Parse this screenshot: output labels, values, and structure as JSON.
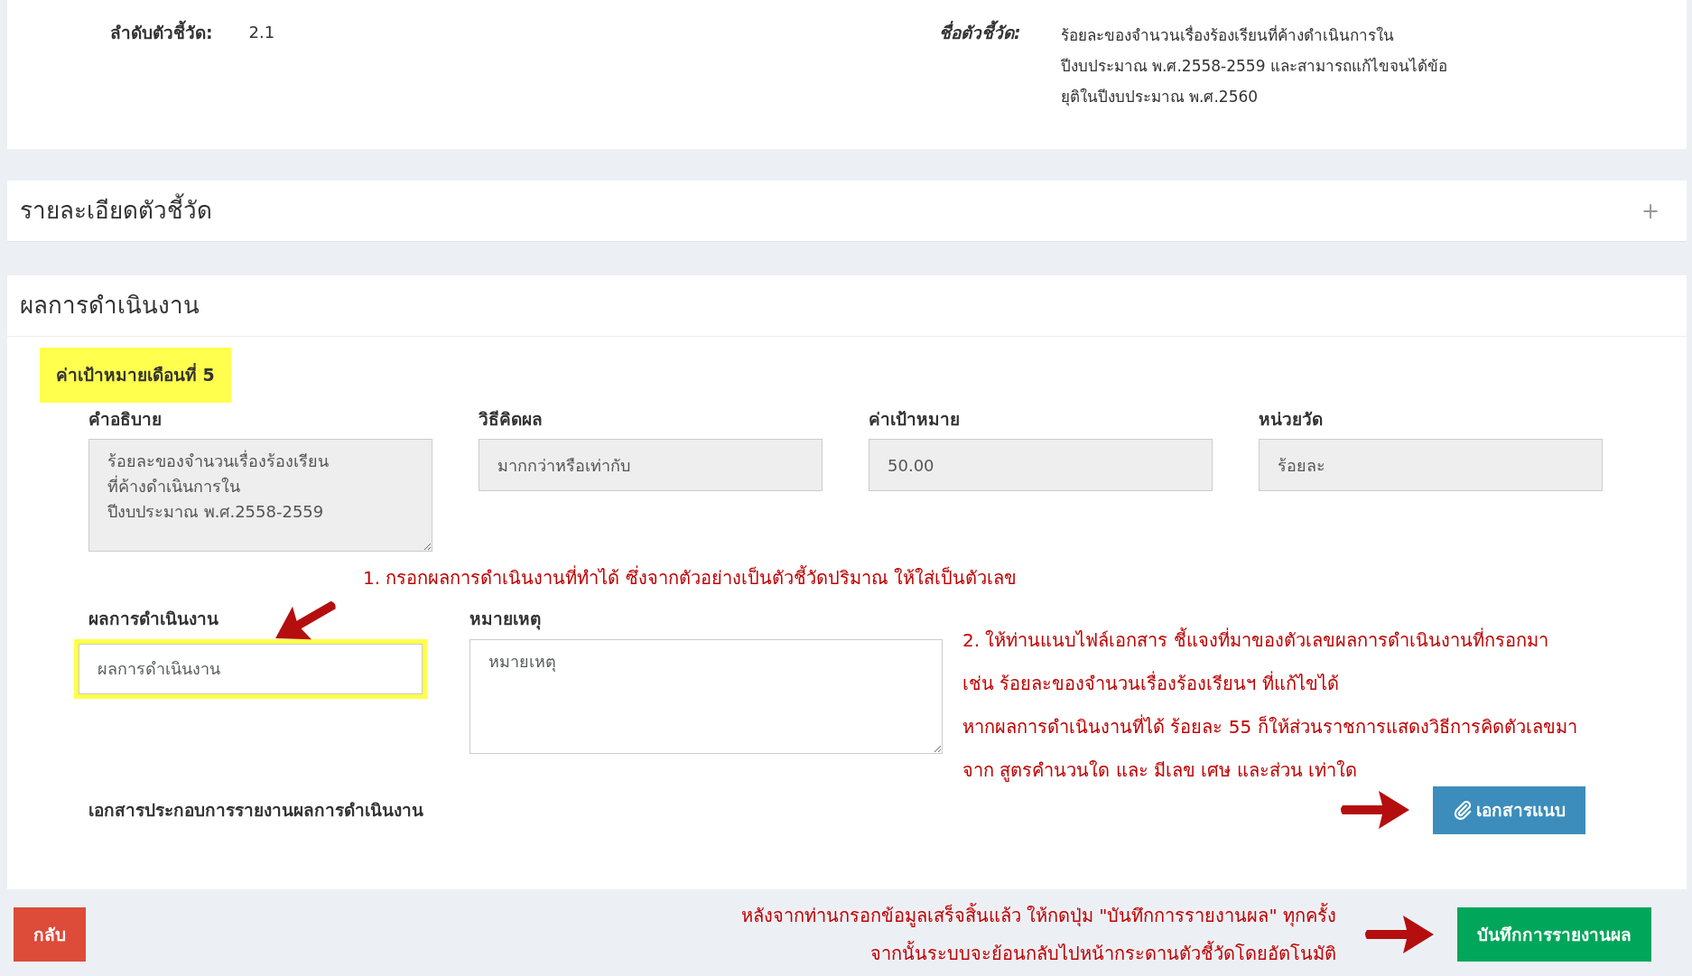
{
  "indicator": {
    "order_label": "ลำดับตัวชี้วัด:",
    "order": "2.1",
    "name_label": "ชื่อตัวชี้วัด:",
    "name_lines": [
      "ร้อยละของจำนวนเรื่องร้องเรียนที่ค้างดำเนินการใน",
      "ปีงบประมาณ พ.ศ.2558-2559 และสามารถแก้ไขจนได้ข้อ",
      "ยุติในปีงบประมาณ พ.ศ.2560"
    ]
  },
  "details_panel": {
    "title": "รายละเอียดตัวชี้วัด",
    "toggle": "+"
  },
  "results_panel": {
    "title": "ผลการดำเนินงาน",
    "target_tag": "ค่าเป้าหมายเดือนที่ 5",
    "target_fields": [
      {
        "kind": "textarea",
        "label": "คำอธิบาย",
        "value": "ร้อยละของจำนวนเรื่องร้องเรียน\nที่ค้างดำเนินการใน\nปีงบประมาณ พ.ศ.2558-2559",
        "disabled": true
      },
      {
        "kind": "select",
        "label": "วิธีคิดผล",
        "value": "มากกว่าหรือเท่ากับ",
        "disabled": true
      },
      {
        "kind": "input",
        "label": "ค่าเป้าหมาย",
        "value": "50.00",
        "disabled": true
      },
      {
        "kind": "input",
        "label": "หน่วยวัด",
        "value": "ร้อยละ",
        "disabled": true
      }
    ],
    "note_1": "1. กรอกผลการดำเนินงานที่ทำได้ ซึ่งจากตัวอย่างเป็นตัวชี้วัดปริมาณ ให้ใส่เป็นตัวเลข",
    "entry_fields": [
      {
        "kind": "input",
        "label": "ผลการดำเนินงาน",
        "placeholder": "ผลการดำเนินงาน",
        "disabled": false,
        "highlighted": true
      },
      {
        "kind": "textarea",
        "label": "หมายเหตุ",
        "placeholder": "หมายเหตุ",
        "disabled": false,
        "highlighted": false
      }
    ],
    "note_2_lines": [
      "2. ให้ท่านแนบไฟล์เอกสาร ชี้แจงที่มาของตัวเลขผลการดำเนินงานที่กรอกมา",
      "เช่น ร้อยละของจำนวนเรื่องร้องเรียนฯ ที่แก้ไขได้",
      "หากผลการดำเนินงานที่ได้ ร้อยละ 55 ก็ให้ส่วนราชการแสดงวิธีการคิดตัวเลขมา",
      "จาก สูตรคำนวนใด และ มีเลข เศษ และส่วน เท่าใด"
    ],
    "attachments_label": "เอกสารประกอบการรายงานผลการดำเนินงาน",
    "attach_button": "เอกสารแนบ"
  },
  "footer": {
    "back_button": "กลับ",
    "note_lines": [
      "หลังจากท่านกรอกข้อมูลเสร็จสิ้นแล้ว ให้กดปุ่ม \"บันทึกการรายงานผล\" ทุกครั้ง",
      "จากนั้นระบบจะย้อนกลับไปหน้ากระดานตัวชี้วัดโดยอัตโนมัติ"
    ],
    "save_button": "บันทึกการรายงานผล"
  }
}
